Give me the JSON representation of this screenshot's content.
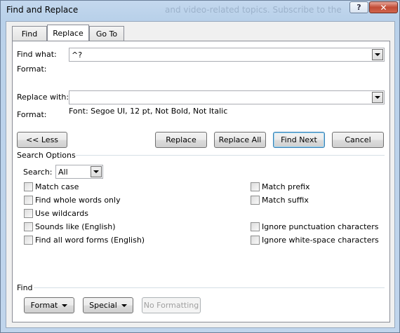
{
  "window": {
    "title": "Find and Replace",
    "background_text": "and video-related topics. Subscribe to the",
    "help_symbol": "?",
    "close_symbol": "✕"
  },
  "tabs": [
    {
      "label": "Find",
      "active": false
    },
    {
      "label": "Replace",
      "active": true
    },
    {
      "label": "Go To",
      "active": false
    }
  ],
  "find": {
    "label": "Find what:",
    "value": "^?",
    "format_label": "Format:",
    "format_value": ""
  },
  "replace": {
    "label": "Replace with:",
    "value": "",
    "format_label": "Format:",
    "format_value": "Font: Segoe UI, 12 pt, Not Bold, Not Italic"
  },
  "buttons": {
    "less": "<< Less",
    "replace": "Replace",
    "replace_all": "Replace All",
    "find_next": "Find Next",
    "cancel": "Cancel"
  },
  "search_options": {
    "heading": "Search Options",
    "search_label": "Search:",
    "search_value": "All",
    "left_options": [
      {
        "label": "Match case",
        "checked": false
      },
      {
        "label": "Find whole words only",
        "checked": false
      },
      {
        "label": "Use wildcards",
        "checked": false
      },
      {
        "label": "Sounds like (English)",
        "checked": false
      },
      {
        "label": "Find all word forms (English)",
        "checked": false
      }
    ],
    "right_options": [
      {
        "label": "Match prefix",
        "checked": false
      },
      {
        "label": "Match suffix",
        "checked": false
      },
      {
        "label": "Ignore punctuation characters",
        "checked": false
      },
      {
        "label": "Ignore white-space characters",
        "checked": false
      }
    ]
  },
  "find_section": {
    "heading": "Find",
    "format_button": "Format",
    "special_button": "Special",
    "no_formatting_button": "No Formatting"
  }
}
